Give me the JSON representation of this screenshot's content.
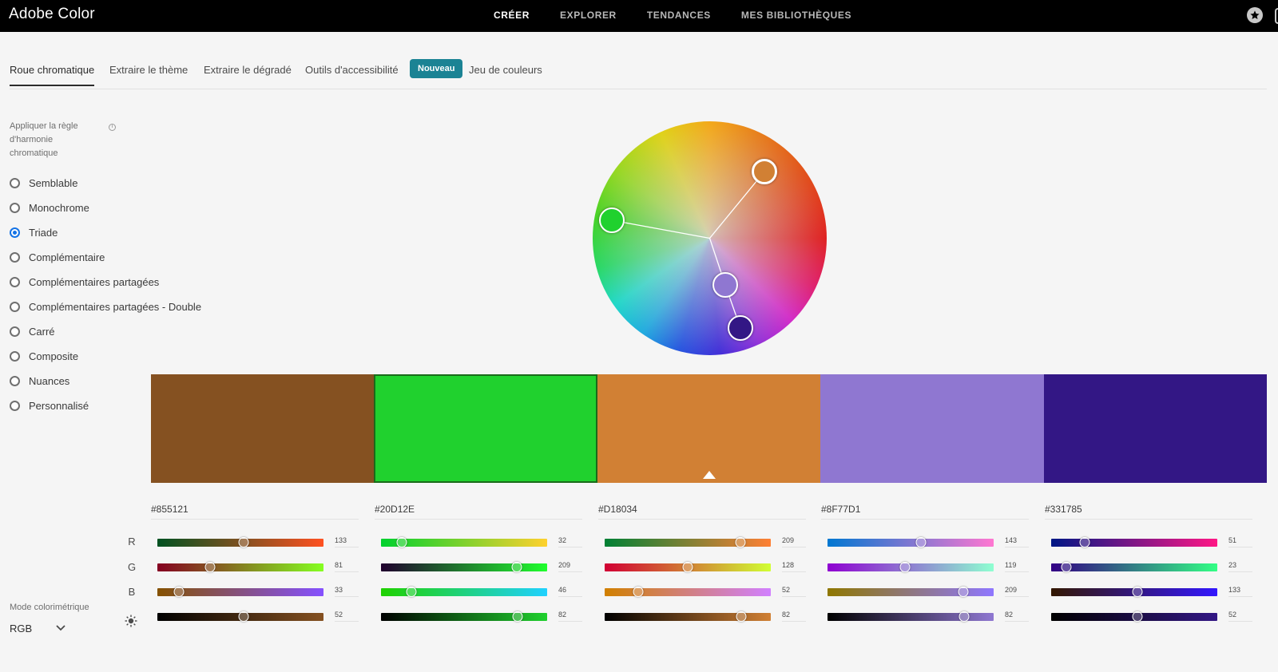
{
  "app": {
    "brand": "Adobe Color"
  },
  "topnav": [
    {
      "label": "CRÉER",
      "active": true
    },
    {
      "label": "EXPLORER",
      "active": false
    },
    {
      "label": "TENDANCES",
      "active": false
    },
    {
      "label": "MES BIBLIOTHÈQUES",
      "active": false
    }
  ],
  "tabs": [
    {
      "label": "Roue chromatique",
      "active": true
    },
    {
      "label": "Extraire le thème"
    },
    {
      "label": "Extraire le dégradé"
    },
    {
      "label": "Outils d'accessibilité"
    },
    {
      "label": "Jeu de couleurs"
    }
  ],
  "badge": "Nouveau",
  "harmony": {
    "label": "Appliquer la règle d'harmonie chromatique",
    "options": [
      {
        "label": "Semblable",
        "checked": false
      },
      {
        "label": "Monochrome",
        "checked": false
      },
      {
        "label": "Triade",
        "checked": true
      },
      {
        "label": "Complémentaire",
        "checked": false
      },
      {
        "label": "Complémentaires partagées",
        "checked": false
      },
      {
        "label": "Complémentaires partagées - Double",
        "checked": false
      },
      {
        "label": "Carré",
        "checked": false
      },
      {
        "label": "Composite",
        "checked": false
      },
      {
        "label": "Nuances",
        "checked": false
      },
      {
        "label": "Personnalisé",
        "checked": false
      }
    ]
  },
  "color_mode": {
    "label": "Mode colorimétrique",
    "value": "RGB"
  },
  "channels": [
    "R",
    "G",
    "B"
  ],
  "brightness_icon": "sun-icon",
  "swatches": [
    {
      "hex": "#855121",
      "color": "#855121",
      "r": 133,
      "g": 81,
      "b": 33,
      "brightness": 52
    },
    {
      "hex": "#20D12E",
      "color": "#20D12E",
      "r": 32,
      "g": 209,
      "b": 46,
      "brightness": 82,
      "selected": true
    },
    {
      "hex": "#D18034",
      "color": "#D18034",
      "r": 209,
      "g": 128,
      "b": 52,
      "brightness": 82,
      "base": true
    },
    {
      "hex": "#8F77D1",
      "color": "#8F77D1",
      "r": 143,
      "g": 119,
      "b": 209,
      "brightness": 82
    },
    {
      "hex": "#331785",
      "color": "#331785",
      "r": 51,
      "g": 23,
      "b": 133,
      "brightness": 52
    }
  ]
}
